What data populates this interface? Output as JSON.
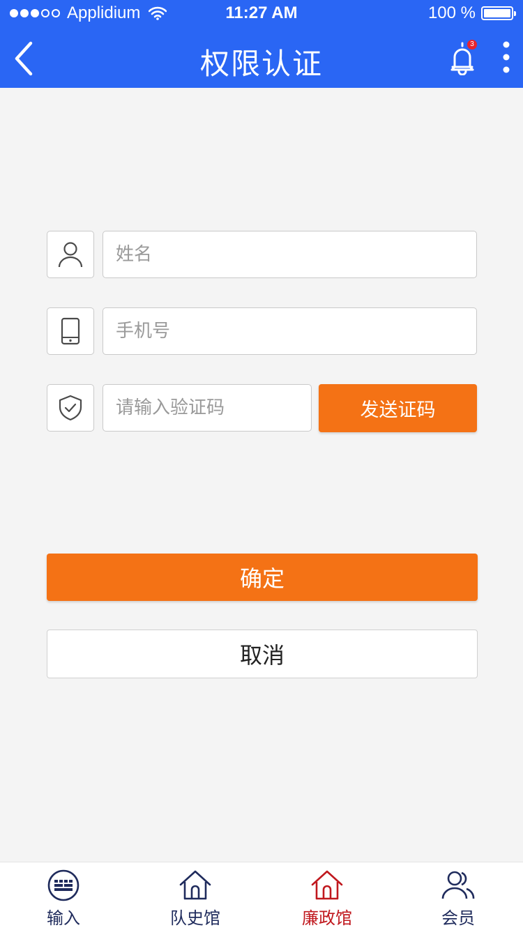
{
  "status_bar": {
    "carrier": "Applidium",
    "time": "11:27 AM",
    "battery": "100 %",
    "signal_dots_filled": 3,
    "signal_dots_total": 5
  },
  "header": {
    "title": "权限认证",
    "back_icon": "chevron-left-icon",
    "bell_icon": "bell-icon",
    "notification_count": "3",
    "more_icon": "more-vertical-icon",
    "background": "#2a66f4"
  },
  "form": {
    "name_placeholder": "姓名",
    "phone_placeholder": "手机号",
    "code_placeholder": "请输入验证码",
    "send_code_label": "发送证码",
    "confirm_label": "确定",
    "cancel_label": "取消",
    "accent": "#f47215"
  },
  "tabbar": {
    "items": [
      {
        "label": "输入",
        "icon": "keyboard-icon",
        "active": false
      },
      {
        "label": "队史馆",
        "icon": "home-icon",
        "active": false
      },
      {
        "label": "廉政馆",
        "icon": "home-icon",
        "active": true
      },
      {
        "label": "会员",
        "icon": "users-icon",
        "active": false
      }
    ],
    "active_color": "#c0181e",
    "inactive_color": "#1f2b5c"
  }
}
